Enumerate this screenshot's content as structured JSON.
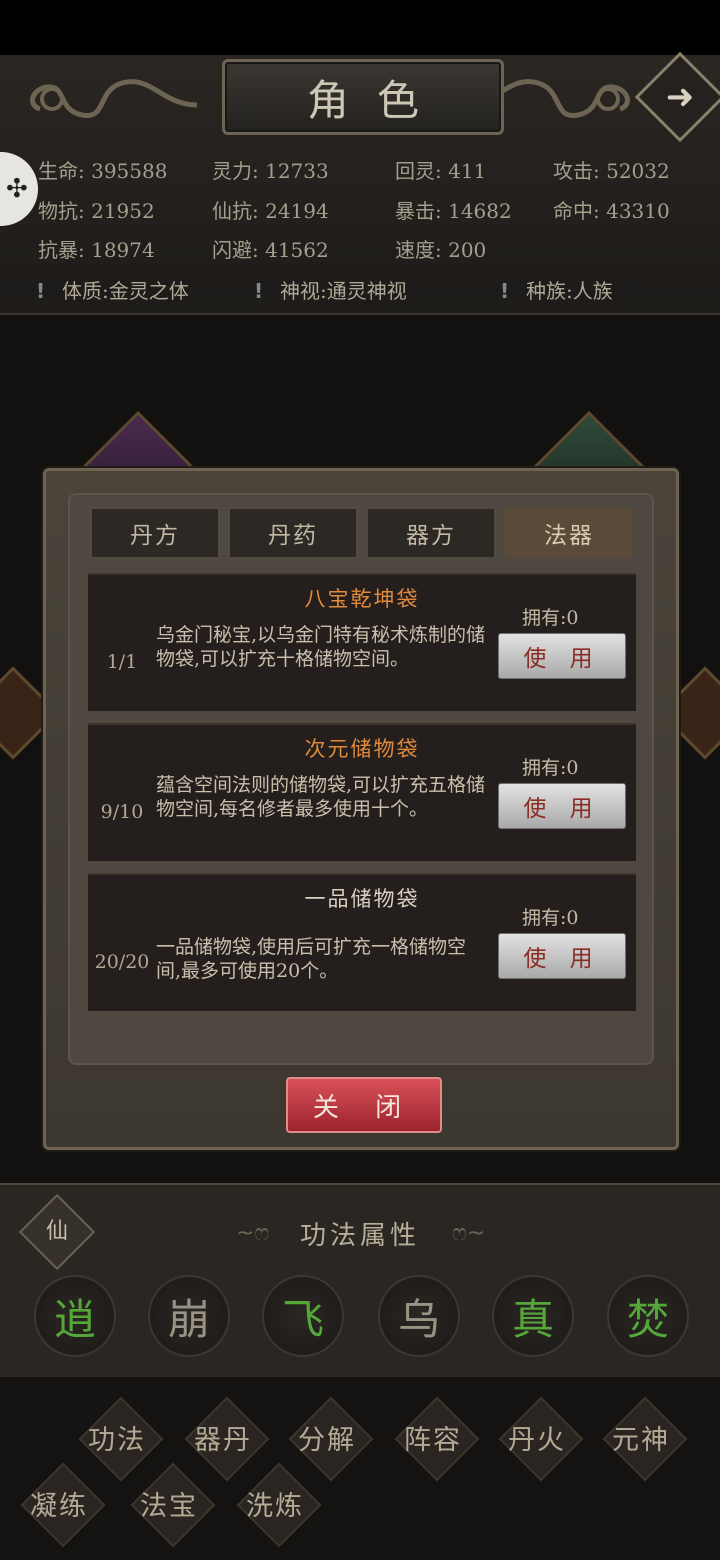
{
  "header": {
    "title": "角色",
    "stats": [
      {
        "label": "生命:",
        "value": "395588"
      },
      {
        "label": "灵力:",
        "value": "12733"
      },
      {
        "label": "回灵:",
        "value": "411"
      },
      {
        "label": "攻击:",
        "value": "52032"
      },
      {
        "label": "物抗:",
        "value": "21952"
      },
      {
        "label": "仙抗:",
        "value": "24194"
      },
      {
        "label": "暴击:",
        "value": "14682"
      },
      {
        "label": "命中:",
        "value": "43310"
      },
      {
        "label": "抗暴:",
        "value": "18974"
      },
      {
        "label": "闪避:",
        "value": "41562"
      },
      {
        "label": "速度:",
        "value": "200"
      }
    ],
    "properties": [
      {
        "text": "体质:金灵之体"
      },
      {
        "text": "神视:通灵神视"
      },
      {
        "text": "种族:人族"
      }
    ],
    "arrow_icon": "arrow-right-icon",
    "side_icon": "puzzle-icon"
  },
  "modal": {
    "tabs": [
      {
        "label": "丹方"
      },
      {
        "label": "丹药"
      },
      {
        "label": "器方"
      },
      {
        "label": "法器",
        "active": true
      }
    ],
    "items": [
      {
        "name": "八宝乾坤袋",
        "name_color": "#e08a3c",
        "count": "1/1",
        "desc": "乌金门秘宝,以乌金门特有秘术炼制的储物袋,可以扩充十格储物空间。",
        "owned": "拥有:0",
        "button": "使 用"
      },
      {
        "name": "次元储物袋",
        "name_color": "#e08a3c",
        "count": "9/10",
        "desc": "蕴含空间法则的储物袋,可以扩充五格储物空间,每名修者最多使用十个。",
        "owned": "拥有:0",
        "button": "使 用"
      },
      {
        "name": "一品储物袋",
        "name_color": "#d9d1c2",
        "count": "20/20",
        "desc": "一品储物袋,使用后可扩充一格储物空间,最多可使用20个。",
        "owned": "拥有:0",
        "button": "使 用"
      }
    ],
    "close_label": "关 闭"
  },
  "gongfa": {
    "badge": "仙",
    "title": "功法属性",
    "chars": [
      {
        "char": "逍",
        "color": "#56a73a"
      },
      {
        "char": "崩",
        "color": "#9a9384"
      },
      {
        "char": "飞",
        "color": "#56a73a"
      },
      {
        "char": "乌",
        "color": "#9a9384"
      },
      {
        "char": "真",
        "color": "#56a73a"
      },
      {
        "char": "焚",
        "color": "#56a73a"
      }
    ]
  },
  "nav": {
    "row1": [
      "功法",
      "器丹",
      "分解",
      "阵容",
      "丹火",
      "元神"
    ],
    "row2": [
      "凝练",
      "法宝",
      "洗炼"
    ]
  }
}
